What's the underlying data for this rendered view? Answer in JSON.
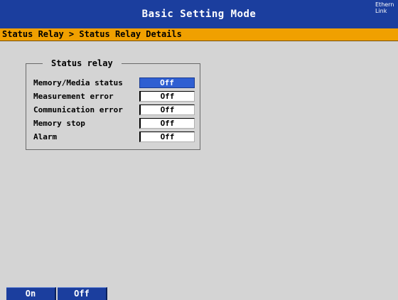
{
  "header": {
    "title": "Basic Setting Mode",
    "ethernet_label": "Ethernet",
    "link_label": "Link",
    "link_led_color": "#19d219"
  },
  "breadcrumb": "Status Relay > Status Relay Details",
  "group": {
    "title": "Status relay",
    "rows": [
      {
        "label": "Memory/Media status",
        "value": "Off",
        "selected": true
      },
      {
        "label": "Measurement error",
        "value": "Off",
        "selected": false
      },
      {
        "label": "Communication error",
        "value": "Off",
        "selected": false
      },
      {
        "label": "Memory stop",
        "value": "Off",
        "selected": false
      },
      {
        "label": "Alarm",
        "value": "Off",
        "selected": false
      }
    ]
  },
  "softkeys": [
    {
      "label": "On"
    },
    {
      "label": "Off"
    }
  ],
  "colors": {
    "title_bar": "#1b3e9e",
    "breadcrumb_bar": "#f0a000",
    "selection": "#2f5fd2",
    "background": "#d4d4d4"
  }
}
